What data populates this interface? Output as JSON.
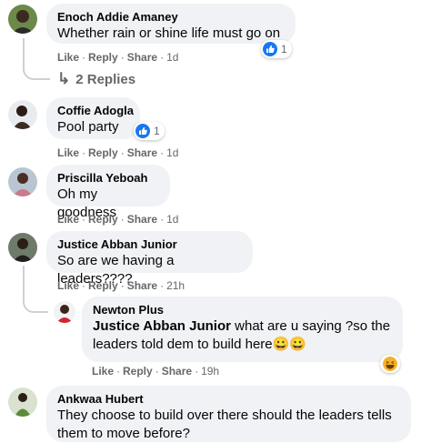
{
  "colors": {
    "bubble": "#f0f2f5",
    "meta": "#65676b",
    "like_blue": "#1877f2",
    "haha_yellow": "#f7b125"
  },
  "comments": [
    {
      "author": "Enoch Addie Amaney",
      "text": "Whether rain or shine life must go on",
      "reaction": {
        "icon": "like-icon",
        "count": "1"
      },
      "like": "Like",
      "reply": "Reply",
      "share": "Share",
      "time": "1d",
      "replies_link": "2 Replies"
    },
    {
      "author": "Coffie Adogla",
      "text": "Pool party",
      "reaction": {
        "icon": "like-icon",
        "count": "1"
      },
      "like": "Like",
      "reply": "Reply",
      "share": "Share",
      "time": "1d"
    },
    {
      "author": "Priscilla Yeboah",
      "text": "Oh my goodness",
      "like": "Like",
      "reply": "Reply",
      "share": "Share",
      "time": "1d"
    },
    {
      "author": "Justice Abban Junior",
      "text": "So are we having a leaders????",
      "like": "Like",
      "reply": "Reply",
      "share": "Share",
      "time": "21h"
    },
    {
      "author": "Newton Plus",
      "mention": "Justice Abban Junior",
      "text_line1": " what are u saying ?so the",
      "text_line2": "leaders told dem to build here",
      "emoji_text": "😀😀",
      "reaction": {
        "icon": "haha-icon",
        "count": ""
      },
      "like": "Like",
      "reply": "Reply",
      "share": "Share",
      "time": "19h"
    },
    {
      "author": "Ankwaa Hubert",
      "text_line1": "They choose to build over there should the leaders tells",
      "text_line2": "them to move before?"
    }
  ]
}
